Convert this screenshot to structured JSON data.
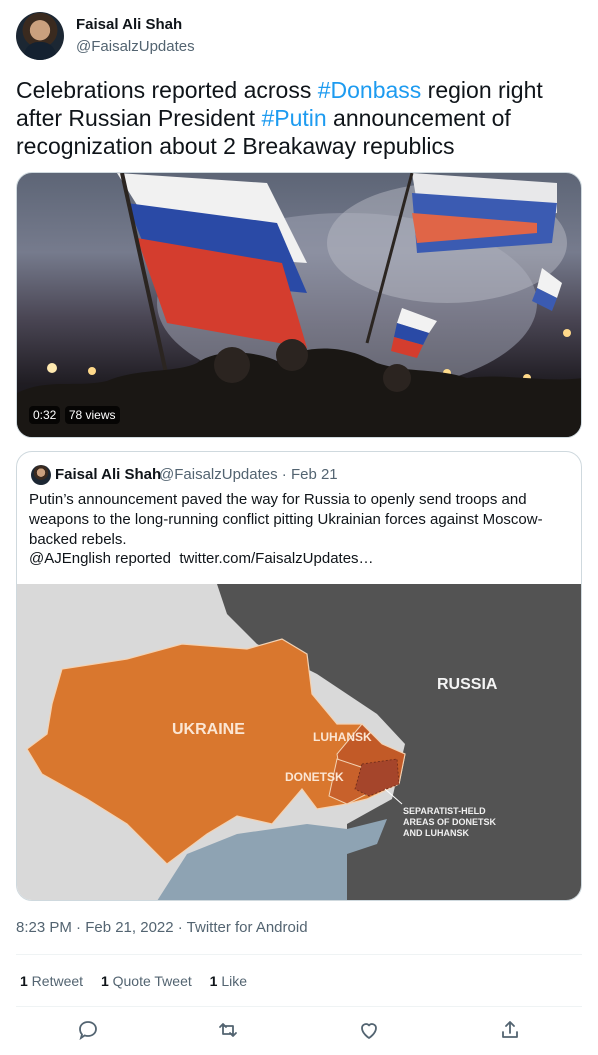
{
  "author": {
    "name": "Faisal Ali Shah",
    "handle": "@FaisalzUpdates"
  },
  "tweet": {
    "segments": [
      {
        "text": "Celebrations reported across ",
        "tag": false
      },
      {
        "text": "#Donbass",
        "tag": true
      },
      {
        "text": " region right after Russian President ",
        "tag": false
      },
      {
        "text": "#Putin",
        "tag": true
      },
      {
        "text": " announcement of recognization about 2 Breakaway republics",
        "tag": false
      }
    ]
  },
  "video": {
    "duration": "0:32",
    "views": "78 views"
  },
  "quote": {
    "name": "Faisal Ali Shah",
    "handle": "@FaisalzUpdates",
    "separator": "·",
    "date": "Feb 21",
    "text": "Putin’s announcement paved the way for Russia to openly send troops and weapons to the long-running conflict pitting Ukrainian forces against Moscow-backed rebels.",
    "mention": "@AJEnglish",
    "reported": " reported  ",
    "link": "twitter.com/FaisalzUpdates…",
    "map": {
      "russia": "RUSSIA",
      "ukraine": "UKRAINE",
      "luhansk": "LUHANSK",
      "donetsk": "DONETSK",
      "legend_line1": "SEPARATIST-HELD",
      "legend_line2": "AREAS OF DONETSK",
      "legend_line3": "AND LUHANSK"
    }
  },
  "meta": {
    "time": "8:23 PM · Feb 21, 2022 · Twitter for Android"
  },
  "stats": {
    "retweets_count": "1",
    "retweets_label": " Retweet",
    "quotes_count": "1",
    "quotes_label": " Quote Tweet",
    "likes_count": "1",
    "likes_label": " Like"
  },
  "colors": {
    "link": "#1d9bf0",
    "ukraine": "#d9772e",
    "russia": "#535353",
    "separatist": "#a5452b"
  }
}
